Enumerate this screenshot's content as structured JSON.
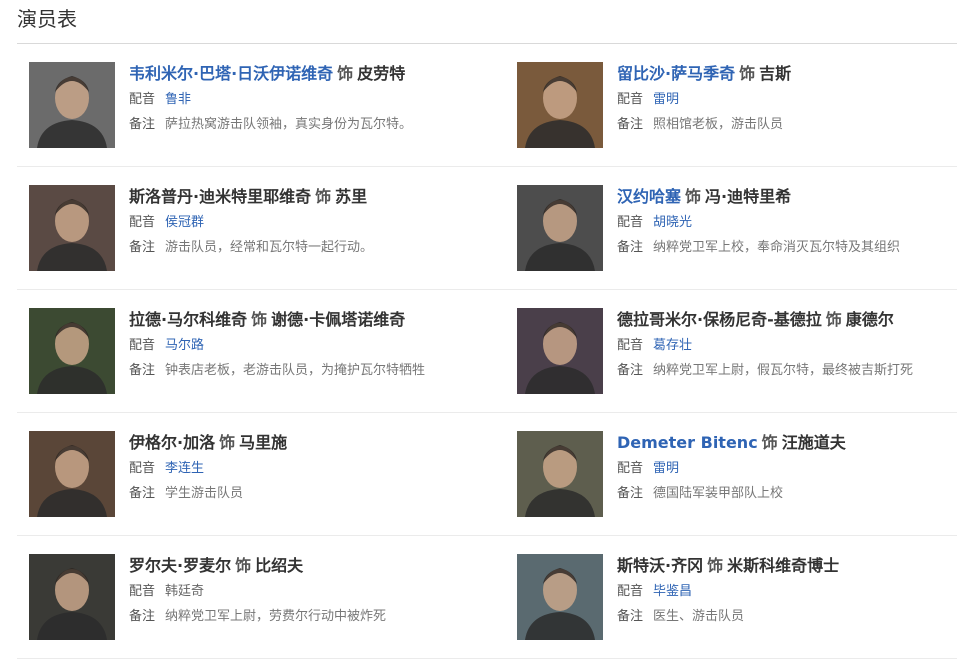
{
  "heading": "演员表",
  "labels": {
    "sep": "饰",
    "voice": "配音",
    "note": "备注"
  },
  "cast": [
    {
      "actor": "韦利米尔·巴塔·日沃伊诺维奇",
      "actor_link": true,
      "role": "皮劳特",
      "voice": "鲁非",
      "voice_link": true,
      "note": "萨拉热窝游击队领袖，真实身份为瓦尔特。",
      "tone": "#6b6b6b"
    },
    {
      "actor": "留比沙·萨马季奇",
      "actor_link": true,
      "role": "吉斯",
      "voice": "雷明",
      "voice_link": true,
      "note": "照相馆老板，游击队员",
      "tone": "#7a5a3c"
    },
    {
      "actor": "斯洛普丹·迪米特里耶维奇",
      "actor_link": false,
      "role": "苏里",
      "voice": "侯冠群",
      "voice_link": true,
      "note": "游击队员，经常和瓦尔特一起行动。",
      "tone": "#5a4a44"
    },
    {
      "actor": "汉约哈塞",
      "actor_link": true,
      "role": "冯·迪特里希",
      "voice": "胡晓光",
      "voice_link": true,
      "note": "纳粹党卫军上校，奉命消灭瓦尔特及其组织",
      "tone": "#4d4d4d"
    },
    {
      "actor": "拉德·马尔科维奇",
      "actor_link": false,
      "role": "谢德·卡佩塔诺维奇",
      "voice": "马尔路",
      "voice_link": true,
      "note": "钟表店老板，老游击队员，为掩护瓦尔特牺牲",
      "tone": "#3c4a32"
    },
    {
      "actor": "德拉哥米尔·保杨尼奇-基德拉",
      "actor_link": false,
      "role": "康德尔",
      "voice": "葛存壮",
      "voice_link": true,
      "note": "纳粹党卫军上尉，假瓦尔特，最终被吉斯打死",
      "tone": "#4a3f4a"
    },
    {
      "actor": "伊格尔·加洛",
      "actor_link": false,
      "role": "马里施",
      "voice": "李连生",
      "voice_link": true,
      "note": "学生游击队员",
      "tone": "#5a4638"
    },
    {
      "actor": "Demeter Bitenc",
      "actor_link": true,
      "role": "汪施道夫",
      "voice": "雷明",
      "voice_link": true,
      "note": "德国陆军装甲部队上校",
      "tone": "#5e5e4e"
    },
    {
      "actor": "罗尔夫·罗麦尔",
      "actor_link": false,
      "role": "比绍夫",
      "voice": "韩廷奇",
      "voice_link": false,
      "note": "纳粹党卫军上尉，劳费尔行动中被炸死",
      "tone": "#3a3a36"
    },
    {
      "actor": "斯特沃·齐冈",
      "actor_link": false,
      "role": "米斯科维奇博士",
      "voice": "毕鉴昌",
      "voice_link": true,
      "note": "医生、游击队员",
      "tone": "#5a6a70"
    }
  ]
}
